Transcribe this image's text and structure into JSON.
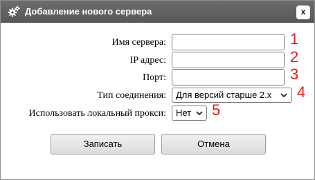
{
  "dialog": {
    "title": "Добавление нового сервера",
    "title_icon": "gears-icon",
    "close_label": "x"
  },
  "form": {
    "server_name": {
      "label": "Имя сервера:",
      "value": "",
      "marker": "1"
    },
    "ip_address": {
      "label": "IP адрес:",
      "value": "",
      "marker": "2"
    },
    "port": {
      "label": "Порт:",
      "value": "",
      "marker": "3"
    },
    "connection_type": {
      "label": "Тип соединения:",
      "selected": "Для версий старше 2.x",
      "marker": "4"
    },
    "local_proxy": {
      "label": "Использовать локальный прокси:",
      "selected": "Нет",
      "marker": "5"
    }
  },
  "buttons": {
    "save_label": "Записать",
    "cancel_label": "Отмена"
  },
  "colors": {
    "titlebar": "#616161",
    "marker": "#e21a1a"
  }
}
